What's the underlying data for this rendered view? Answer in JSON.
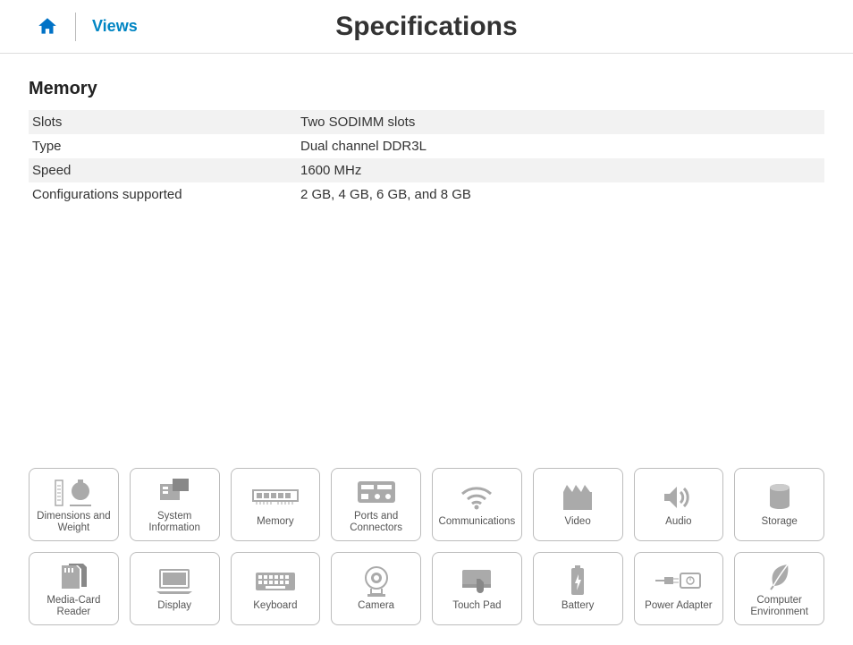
{
  "header": {
    "views_label": "Views",
    "title": "Specifications"
  },
  "section": {
    "title": "Memory",
    "rows": [
      {
        "key": "Slots",
        "value": "Two SODIMM slots"
      },
      {
        "key": "Type",
        "value": "Dual channel DDR3L"
      },
      {
        "key": "Speed",
        "value": "1600 MHz"
      },
      {
        "key": "Configurations supported",
        "value": "2 GB, 4 GB, 6 GB, and 8 GB"
      }
    ]
  },
  "tiles": {
    "row1": [
      {
        "label": "Dimensions and Weight"
      },
      {
        "label": "System Information"
      },
      {
        "label": "Memory"
      },
      {
        "label": "Ports and Connectors"
      },
      {
        "label": "Communications"
      },
      {
        "label": "Video"
      },
      {
        "label": "Audio"
      },
      {
        "label": "Storage"
      }
    ],
    "row2": [
      {
        "label": "Media-Card Reader"
      },
      {
        "label": "Display"
      },
      {
        "label": "Keyboard"
      },
      {
        "label": "Camera"
      },
      {
        "label": "Touch Pad"
      },
      {
        "label": "Battery"
      },
      {
        "label": "Power Adapter"
      },
      {
        "label": "Computer Environment"
      }
    ]
  }
}
